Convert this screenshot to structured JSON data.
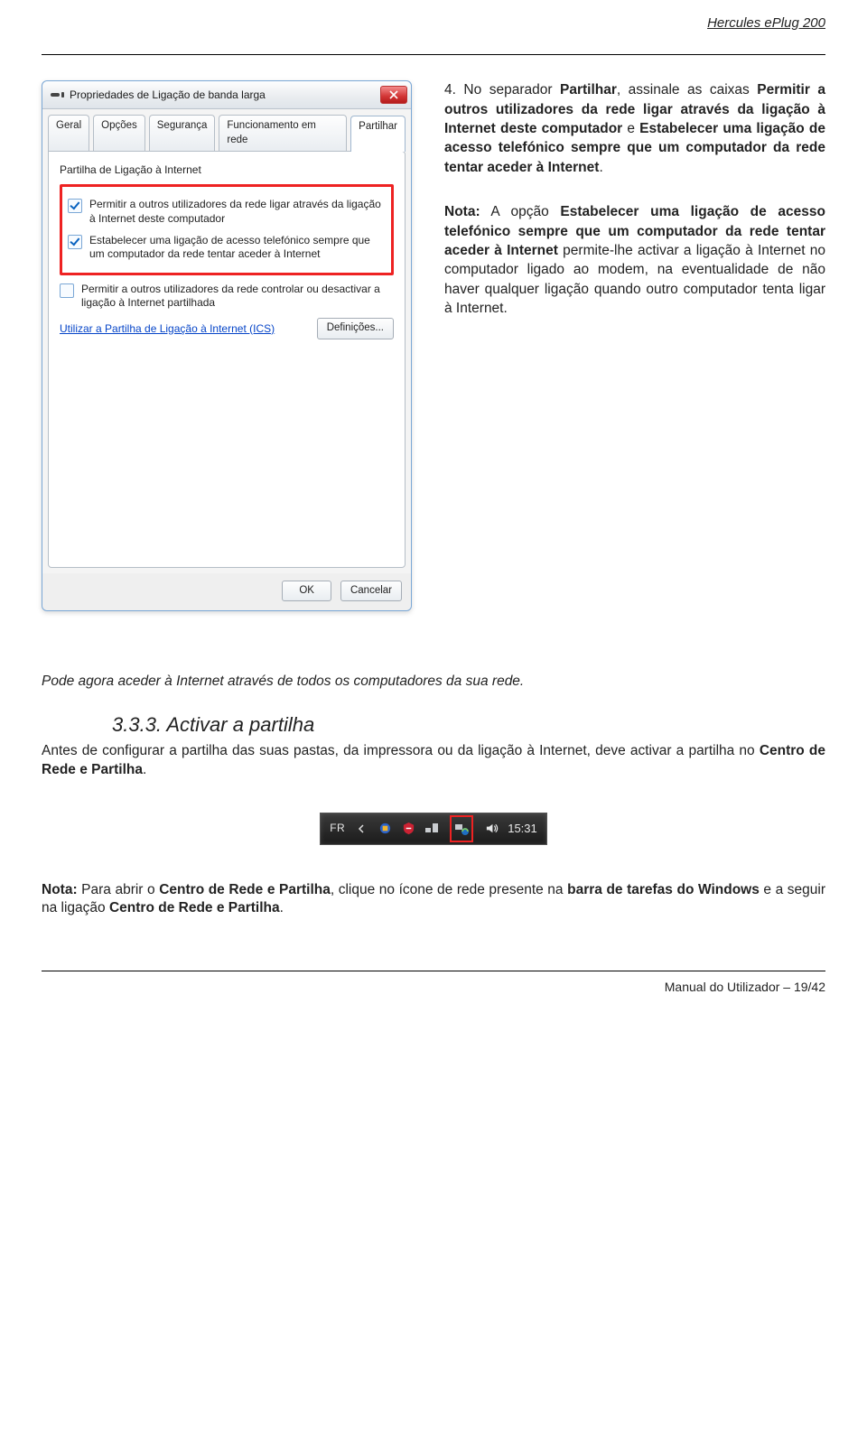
{
  "header": {
    "title": "Hercules ePlug 200"
  },
  "dialog": {
    "title": "Propriedades de Ligação de banda larga",
    "tabs": [
      "Geral",
      "Opções",
      "Segurança",
      "Funcionamento em rede",
      "Partilhar"
    ],
    "active_tab": "Partilhar",
    "group": "Partilha de Ligação à Internet",
    "opt1": "Permitir a outros utilizadores da rede ligar através da ligação à Internet deste computador",
    "opt2": "Estabelecer uma ligação de acesso telefónico sempre que um computador da rede tentar aceder à Internet",
    "opt3": "Permitir a outros utilizadores da rede controlar ou desactivar a ligação à Internet partilhada",
    "ics_link": "Utilizar a Partilha de Ligação à Internet (ICS)",
    "defs_btn": "Definições...",
    "ok": "OK",
    "cancel": "Cancelar"
  },
  "step4": {
    "lead": "4. No separador ",
    "s1": "Partilhar",
    "m1": ", assinale as caixas ",
    "s2": "Permitir a outros utilizadores da rede ligar através da ligação à Internet deste computador",
    "m2": " e ",
    "s3": "Estabelecer uma ligação de acesso telefónico sempre que um computador da rede tentar aceder à Internet",
    "end": "."
  },
  "note1": {
    "pre": "Nota:",
    "m0": " A opção ",
    "b1": "Estabelecer uma ligação de acesso telefónico sempre que um computador da rede tentar aceder à Internet",
    "m1": " permite-lhe activar a ligação à Internet no computador ligado ao modem, na eventualidade de não haver qualquer ligação quando outro computador tenta ligar à Internet."
  },
  "mid": "Pode agora aceder à Internet através de todos os computadores da sua rede.",
  "sec333": {
    "num": "3.3.3.",
    "title": "Activar a partilha"
  },
  "sec_body": {
    "m0": "Antes de configurar a partilha das suas pastas, da impressora ou da ligação à Internet, deve activar a partilha no ",
    "b1": "Centro de Rede e Partilha",
    "m1": "."
  },
  "tray": {
    "lang": "FR",
    "time": "15:31"
  },
  "note2": {
    "pre": "Nota:",
    "m0": " Para abrir o ",
    "b1": "Centro de Rede e Partilha",
    "m1": ", clique no ícone de rede presente na ",
    "b2": "barra de tarefas do Windows",
    "m2": " e a seguir na ligação ",
    "b3": "Centro de Rede e Partilha",
    "m3": "."
  },
  "pagefoot": {
    "text": "Manual do Utilizador – 19/42"
  }
}
